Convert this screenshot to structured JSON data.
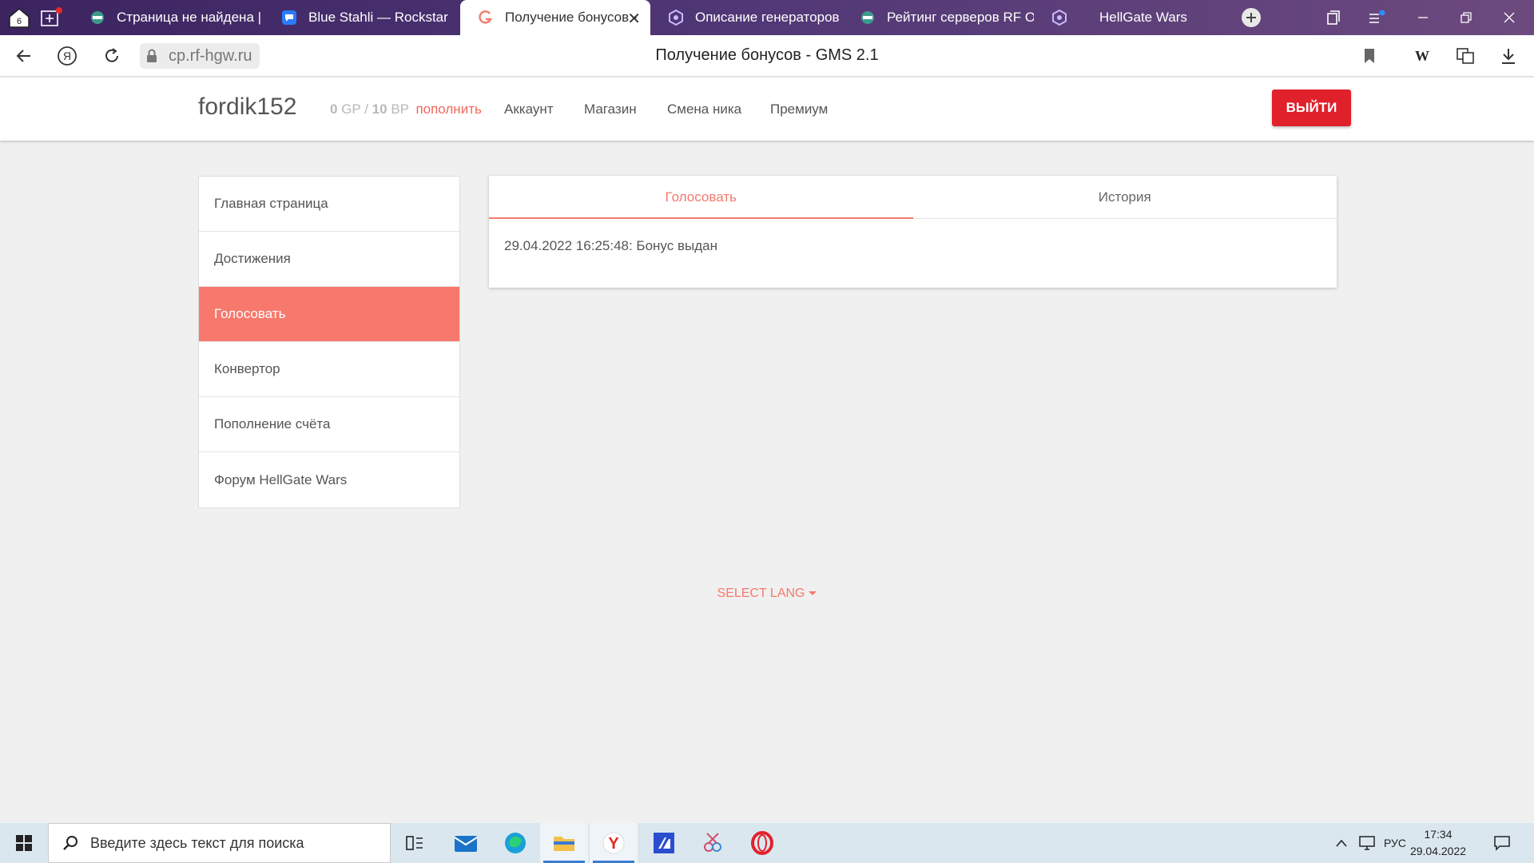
{
  "browser": {
    "tab_count": "6",
    "tabs": [
      {
        "title": "Страница не найдена | Р",
        "icon": "hgw-favicon-icon",
        "active": false
      },
      {
        "title": "Blue Stahli — Rockstar",
        "icon": "music-app-icon",
        "active": false
      },
      {
        "title": "Получение бонусов -",
        "icon": "gms-favicon-icon",
        "active": true
      },
      {
        "title": "Описание генераторов |",
        "icon": "cube-favicon-icon",
        "active": false
      },
      {
        "title": "Рейтинг серверов RF On",
        "icon": "hgw-favicon-icon",
        "active": false
      },
      {
        "title": "HellGate Wars",
        "icon": "cube-favicon-icon",
        "active": false
      }
    ],
    "url": "cp.rf-hgw.ru",
    "page_title": "Получение бонусов - GMS 2.1"
  },
  "header": {
    "username": "fordik152",
    "gp_value": "0",
    "gp_unit": "GP",
    "separator": "/",
    "bp_value": "10",
    "bp_unit": "BP",
    "topup_label": "пополнить",
    "nav": [
      "Аккаунт",
      "Магазин",
      "Смена ника",
      "Премиум"
    ],
    "logout_label": "ВЫЙТИ"
  },
  "sidebar": {
    "items": [
      {
        "label": "Главная страница",
        "active": false
      },
      {
        "label": "Достижения",
        "active": false
      },
      {
        "label": "Голосовать",
        "active": true
      },
      {
        "label": "Конвертор",
        "active": false
      },
      {
        "label": "Пополнение счёта",
        "active": false
      },
      {
        "label": "Форум HellGate Wars",
        "active": false
      }
    ]
  },
  "main": {
    "tabs": [
      {
        "label": "Голосовать",
        "active": true
      },
      {
        "label": "История",
        "active": false
      }
    ],
    "message": "29.04.2022 16:25:48: Бонус выдан"
  },
  "footer": {
    "lang_label": "SELECT LANG"
  },
  "taskbar": {
    "search_placeholder": "Введите здесь текст для поиска",
    "lang": "РУС",
    "time": "17:34",
    "date": "29.04.2022"
  },
  "colors": {
    "accent": "#f47a6c",
    "logout": "#e0202a",
    "tabbar": "#4c3474"
  }
}
